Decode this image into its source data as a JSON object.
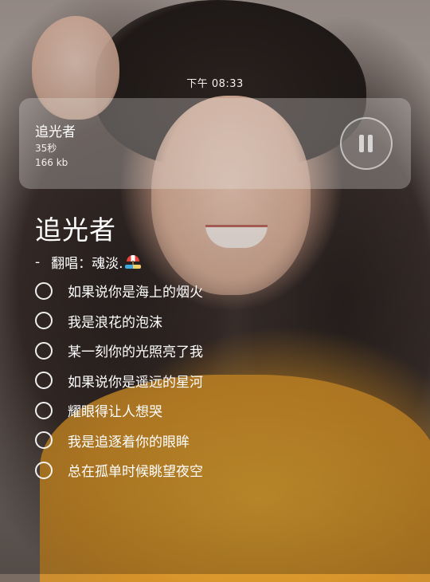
{
  "status": {
    "time": "下午 08:33"
  },
  "audio": {
    "title": "追光者",
    "duration": "35秒",
    "size": "166 kb",
    "state_icon": "pause-icon"
  },
  "song": {
    "title": "追光者",
    "credit_dash": "-",
    "credit": "翻唱：魂淡.",
    "credit_emoji": "beach-umbrella-icon"
  },
  "lyrics": [
    {
      "text": "如果说你是海上的烟火",
      "checked": false
    },
    {
      "text": "我是浪花的泡沫",
      "checked": false
    },
    {
      "text": "某一刻你的光照亮了我",
      "checked": false
    },
    {
      "text": "如果说你是遥远的星河",
      "checked": false
    },
    {
      "text": "耀眼得让人想哭",
      "checked": false
    },
    {
      "text": "我是追逐着你的眼眸",
      "checked": false
    },
    {
      "text": "总在孤单时候眺望夜空",
      "checked": false
    }
  ],
  "colors": {
    "text": "#ffffff",
    "card_background": "rgba(235,232,230,0.30)",
    "shirt": "#e3a52e"
  }
}
